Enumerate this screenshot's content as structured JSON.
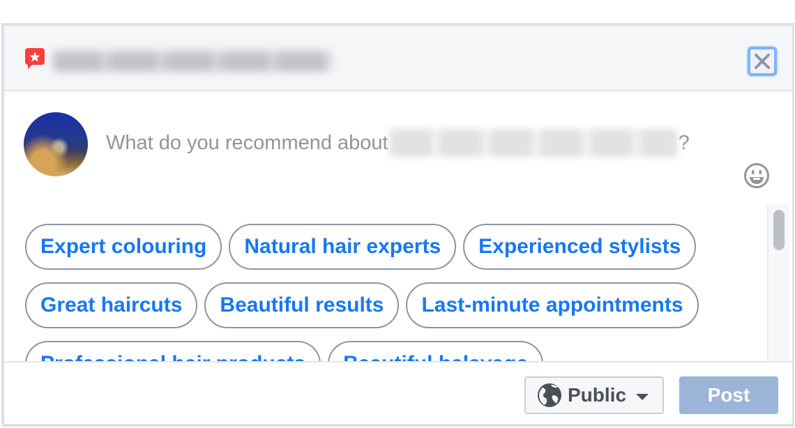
{
  "header": {
    "title": "Smoke Cuts Kids Hair Salon",
    "title_blurred": true,
    "icon": "recommendation-icon",
    "close_label": "Close"
  },
  "composer": {
    "prompt_prefix": "What do you recommend about",
    "page_name": "Smoke Cuts Kids Hair Salon",
    "prompt_suffix": "?",
    "emoji_icon": "smiley-icon"
  },
  "suggestions": [
    "Expert colouring",
    "Natural hair experts",
    "Experienced stylists",
    "Great haircuts",
    "Beautiful results",
    "Last-minute appointments",
    "Professional hair products",
    "Beautiful balayage"
  ],
  "footer": {
    "privacy_label": "Public",
    "privacy_icon": "globe-icon",
    "post_label": "Post",
    "post_enabled": false
  },
  "colors": {
    "accent": "#1877f2",
    "post_disabled": "#9cb4d8",
    "brand_icon": "#fa3e3e"
  }
}
